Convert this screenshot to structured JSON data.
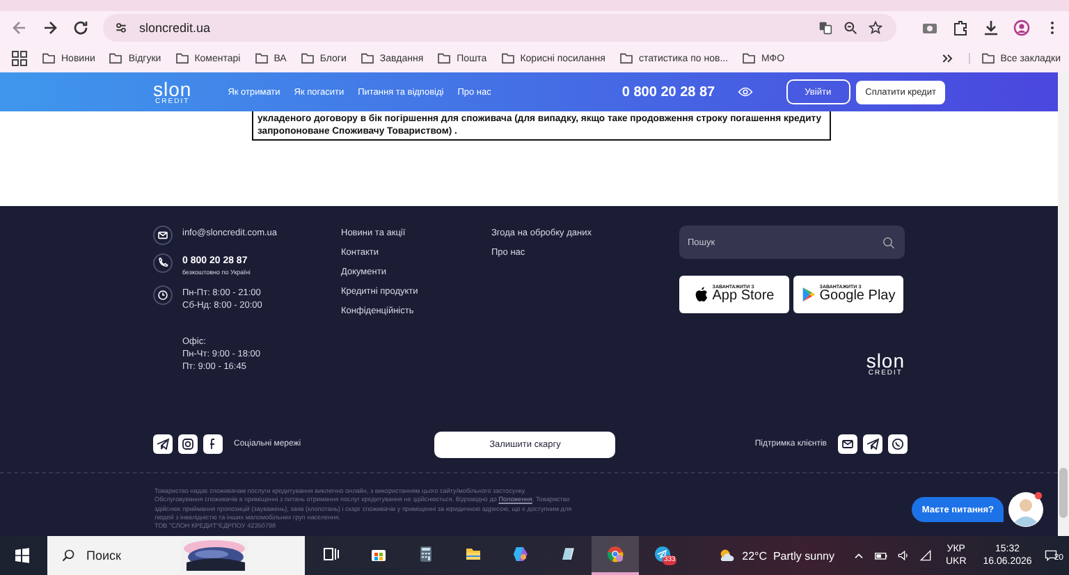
{
  "browser": {
    "url": "sloncredit.ua",
    "bookmarks": [
      "Новини",
      "Відгуки",
      "Коментарі",
      "ВА",
      "Блоги",
      "Завдання",
      "Пошта",
      "Корисні посилання",
      "статистика по нов...",
      "МФО"
    ],
    "all_bookmarks": "Все закладки"
  },
  "site_header": {
    "logo": "slon",
    "logo_sub": "CREDIT",
    "nav": [
      "Як отримати",
      "Як погасити",
      "Питання та відповіді",
      "Про нас"
    ],
    "phone": "0 800 20 28 87",
    "login": "Увійти",
    "pay": "Сплатити кредит"
  },
  "notice": "укладеного договору в бік погіршення для споживача (для випадку, якщо таке продовження строку погашення кредиту запропоноване Споживачу Товариством) .",
  "footer": {
    "contacts": [
      {
        "kind": "email",
        "lines": [
          "info@sloncredit.com.ua"
        ]
      },
      {
        "kind": "phone",
        "lines": [
          "0 800 20 28 87",
          "безкоштовно по Україні"
        ]
      },
      {
        "kind": "clock",
        "lines": [
          "Пн-Пт: 8:00 - 21:00",
          "Сб-Нд: 8:00 - 20:00"
        ]
      },
      {
        "kind": "office",
        "lines": [
          "Офіс:",
          "Пн-Чт: 9:00 - 18:00",
          "Пт: 9:00 - 16:45"
        ]
      }
    ],
    "links_1": [
      "Новини та акції",
      "Контакти",
      "Документи",
      "Кредитні продукти",
      "Конфіденційність"
    ],
    "links_2": [
      "Згода на обробку даних",
      "Про нас"
    ],
    "search_placeholder": "Пошук",
    "stores": [
      {
        "kind": "apple",
        "small": "ЗАВАНТАЖИТИ З",
        "big": "App Store"
      },
      {
        "kind": "google",
        "small": "ЗАВАНТАЖИТИ З",
        "big": "Google Play"
      }
    ],
    "logo": "slon",
    "logo_sub": "CREDIT",
    "social_label": "Соціальні мережі",
    "complaint_button": "Залишити скаргу",
    "support_label": "Підтримка клієнтів",
    "legal": {
      "before": "Товариство надає споживачам послуги кредитування виключно онлайн, з використанням цього сайту/мобільного застосунку. Обслуговування споживачів в приміщенні з питань отримання послуг кредитування не здійснюється. Відповідно до ",
      "link": "Положення",
      "after": ", Товариство здійснює приймання пропозицій (зауважень), заяв (клопотань) і скарг споживачів у приміщенні за юридичною адресою, що є доступним для людей з інвалідністю та інших маломобільних груп населення."
    },
    "company": "ТОВ \"СЛОН КРЕДИТ\"ЄДРПОУ 42350798"
  },
  "chat": {
    "label": "Маєте питання?"
  },
  "taskbar": {
    "search": "Поиск",
    "apps": [
      {
        "kind": "taskview",
        "selected": false
      },
      {
        "kind": "store",
        "selected": false
      },
      {
        "kind": "calculator",
        "selected": false
      },
      {
        "kind": "folder",
        "selected": false
      },
      {
        "kind": "copilot",
        "selected": false
      },
      {
        "kind": "notes",
        "selected": false
      },
      {
        "kind": "chrome",
        "selected": true
      },
      {
        "kind": "telegram",
        "selected": false,
        "badge": "333"
      }
    ],
    "weather": "22°C  Partly sunny",
    "lang": [
      "УКР",
      "UKR"
    ],
    "time": "15:32",
    "date": "16.06.2026",
    "notifications": "20"
  }
}
